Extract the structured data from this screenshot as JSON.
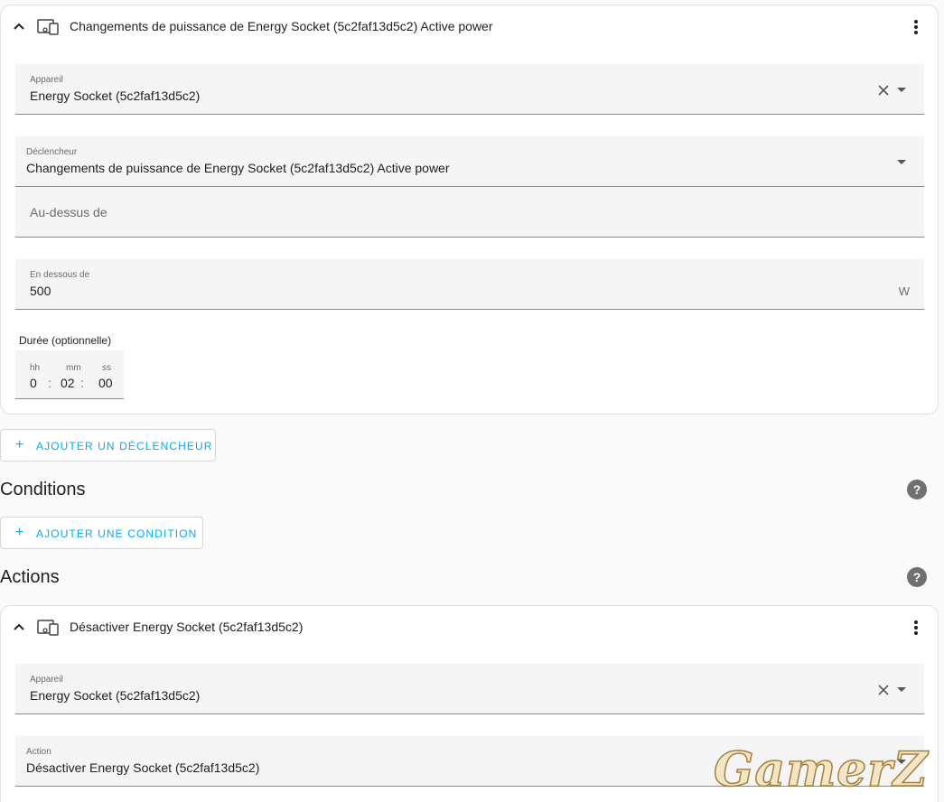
{
  "trigger_card": {
    "title": "Changements de puissance de Energy Socket (5c2faf13d5c2) Active power",
    "device_field": {
      "label": "Appareil",
      "value": "Energy Socket (5c2faf13d5c2)"
    },
    "trigger_field": {
      "label": "Déclencheur",
      "value": "Changements de puissance de Energy Socket (5c2faf13d5c2) Active power"
    },
    "above_field": {
      "placeholder": "Au-dessus de"
    },
    "below_field": {
      "label": "En dessous de",
      "value": "500",
      "suffix": "W"
    },
    "duration": {
      "label": "Durée (optionnelle)",
      "hh_label": "hh",
      "mm_label": "mm",
      "ss_label": "ss",
      "hh": "0",
      "mm": "02",
      "ss": "00",
      "sep": ":"
    }
  },
  "add_trigger_button": {
    "label": "AJOUTER UN DÉCLENCHEUR"
  },
  "conditions": {
    "title": "Conditions",
    "add_label": "AJOUTER UNE CONDITION",
    "help": "?"
  },
  "actions": {
    "title": "Actions",
    "help": "?"
  },
  "action_card": {
    "title": "Désactiver Energy Socket (5c2faf13d5c2)",
    "device_field": {
      "label": "Appareil",
      "value": "Energy Socket (5c2faf13d5c2)"
    },
    "action_field": {
      "label": "Action",
      "value": "Désactiver Energy Socket (5c2faf13d5c2)"
    }
  },
  "icons": {
    "collapse": "chevron-up-icon",
    "device": "devices-icon",
    "menu": "dots-vertical-icon",
    "clear": "close-icon",
    "dropdown": "menu-down-icon",
    "add": "plus-icon",
    "help": "help-circle-icon"
  },
  "colors": {
    "accent": "#03a9f4",
    "field_bg": "#f5f5f5",
    "card_bg": "#ffffff",
    "page_bg": "#fafafa"
  },
  "watermark": "GamerZ"
}
